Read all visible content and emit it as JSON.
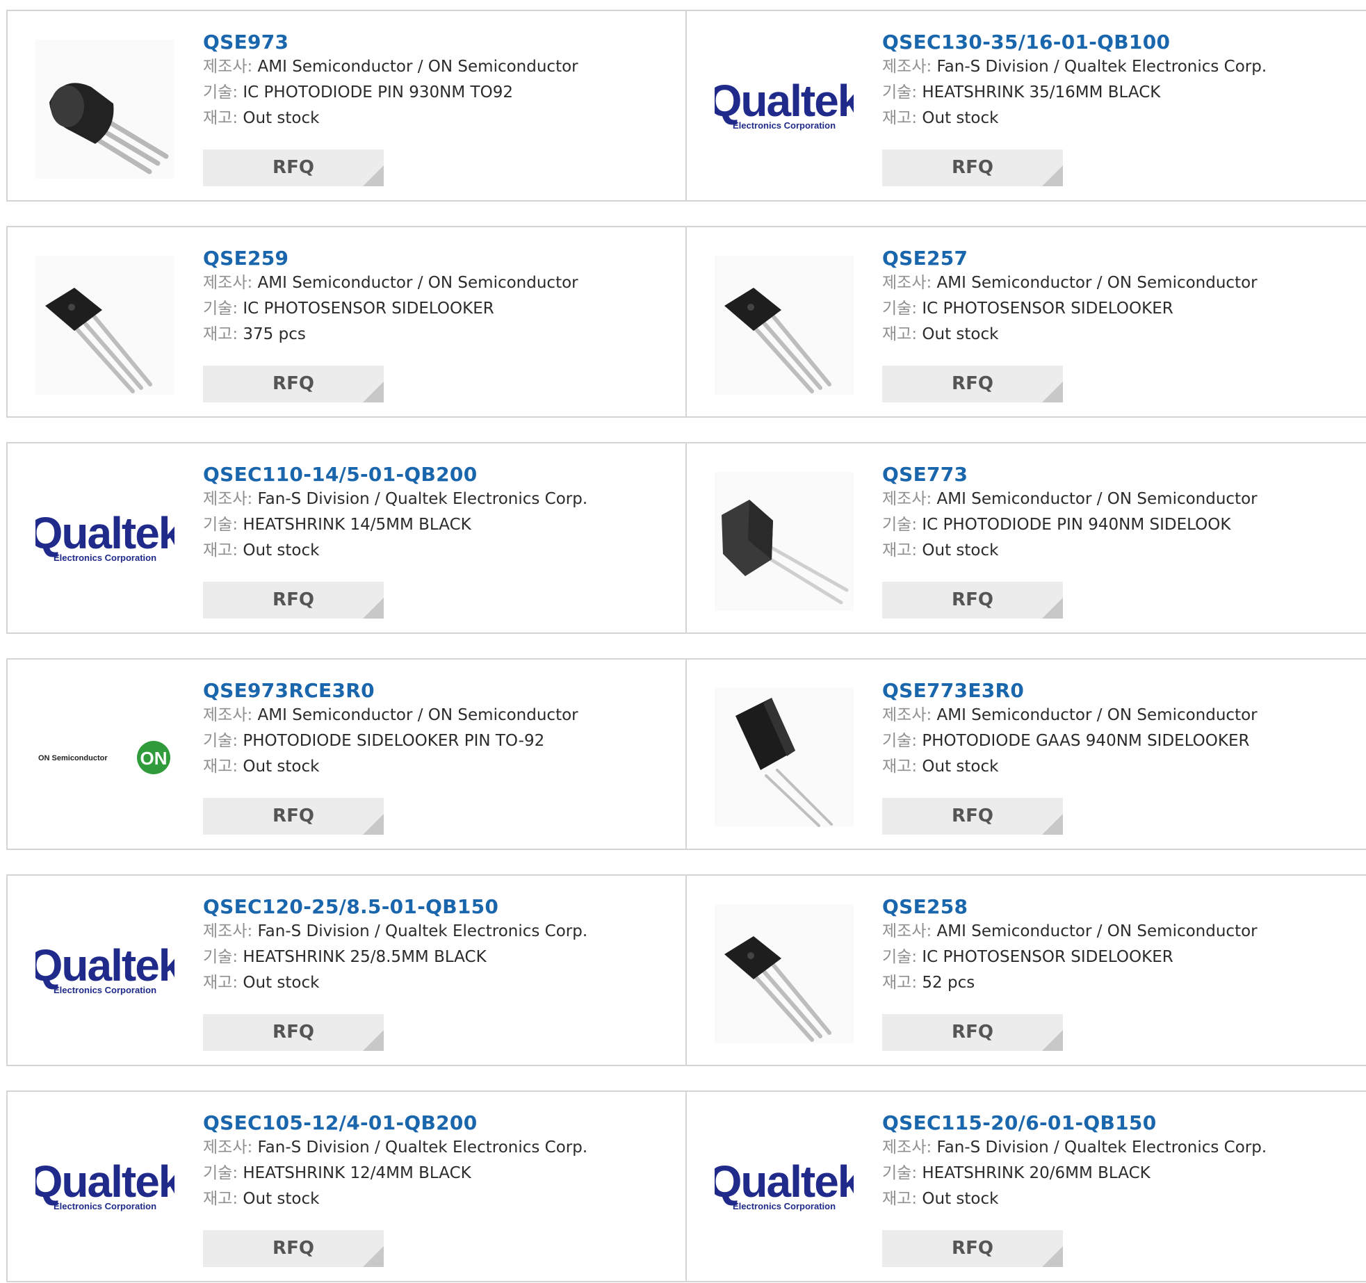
{
  "labels": {
    "manufacturer": "제조사:",
    "description": "기술:",
    "stock": "재고:",
    "rfq": "RFQ"
  },
  "brand": {
    "link_color": "#1a66ad",
    "qualtek_blue": "#1f2a8a",
    "on_green": "#2f9b3a"
  },
  "products": [
    {
      "part": "QSE973",
      "manufacturer": "AMI Semiconductor / ON Semiconductor",
      "description": "IC PHOTODIODE PIN 930NM TO92",
      "stock": "Out stock",
      "image": "to92-transistor"
    },
    {
      "part": "QSEC130-35/16-01-QB100",
      "manufacturer": "Fan-S Division / Qualtek Electronics Corp.",
      "description": "HEATSHRINK 35/16MM BLACK",
      "stock": "Out stock",
      "image": "qualtek-logo",
      "logo_main": "Qualtek",
      "logo_sub": "Electronics Corporation"
    },
    {
      "part": "QSE259",
      "manufacturer": "AMI Semiconductor / ON Semiconductor",
      "description": "IC PHOTOSENSOR SIDELOOKER",
      "stock": "375 pcs",
      "image": "sidelooker-3pin"
    },
    {
      "part": "QSE257",
      "manufacturer": "AMI Semiconductor / ON Semiconductor",
      "description": "IC PHOTOSENSOR SIDELOOKER",
      "stock": "Out stock",
      "image": "sidelooker-3pin"
    },
    {
      "part": "QSEC110-14/5-01-QB200",
      "manufacturer": "Fan-S Division / Qualtek Electronics Corp.",
      "description": "HEATSHRINK 14/5MM BLACK",
      "stock": "Out stock",
      "image": "qualtek-logo",
      "logo_main": "Qualtek",
      "logo_sub": "Electronics Corporation"
    },
    {
      "part": "QSE773",
      "manufacturer": "AMI Semiconductor / ON Semiconductor",
      "description": "IC PHOTODIODE PIN 940NM SIDELOOK",
      "stock": "Out stock",
      "image": "sidelooker-2pin"
    },
    {
      "part": "QSE973RCE3R0",
      "manufacturer": "AMI Semiconductor / ON Semiconductor",
      "description": "PHOTODIODE SIDELOOKER PIN TO-92",
      "stock": "Out stock",
      "image": "on-semi-logo",
      "logo_main": "ON Semiconductor",
      "logo_badge": "ON"
    },
    {
      "part": "QSE773E3R0",
      "manufacturer": "AMI Semiconductor / ON Semiconductor",
      "description": "PHOTODIODE GAAS 940NM SIDELOOKER",
      "stock": "Out stock",
      "image": "sidelooker-2pin-angled"
    },
    {
      "part": "QSEC120-25/8.5-01-QB150",
      "manufacturer": "Fan-S Division / Qualtek Electronics Corp.",
      "description": "HEATSHRINK 25/8.5MM BLACK",
      "stock": "Out stock",
      "image": "qualtek-logo",
      "logo_main": "Qualtek",
      "logo_sub": "Electronics Corporation"
    },
    {
      "part": "QSE258",
      "manufacturer": "AMI Semiconductor / ON Semiconductor",
      "description": "IC PHOTOSENSOR SIDELOOKER",
      "stock": "52 pcs",
      "image": "sidelooker-3pin"
    },
    {
      "part": "QSEC105-12/4-01-QB200",
      "manufacturer": "Fan-S Division / Qualtek Electronics Corp.",
      "description": "HEATSHRINK 12/4MM BLACK",
      "stock": "Out stock",
      "image": "qualtek-logo",
      "logo_main": "Qualtek",
      "logo_sub": "Electronics Corporation"
    },
    {
      "part": "QSEC115-20/6-01-QB150",
      "manufacturer": "Fan-S Division / Qualtek Electronics Corp.",
      "description": "HEATSHRINK 20/6MM BLACK",
      "stock": "Out stock",
      "image": "qualtek-logo",
      "logo_main": "Qualtek",
      "logo_sub": "Electronics Corporation"
    }
  ]
}
